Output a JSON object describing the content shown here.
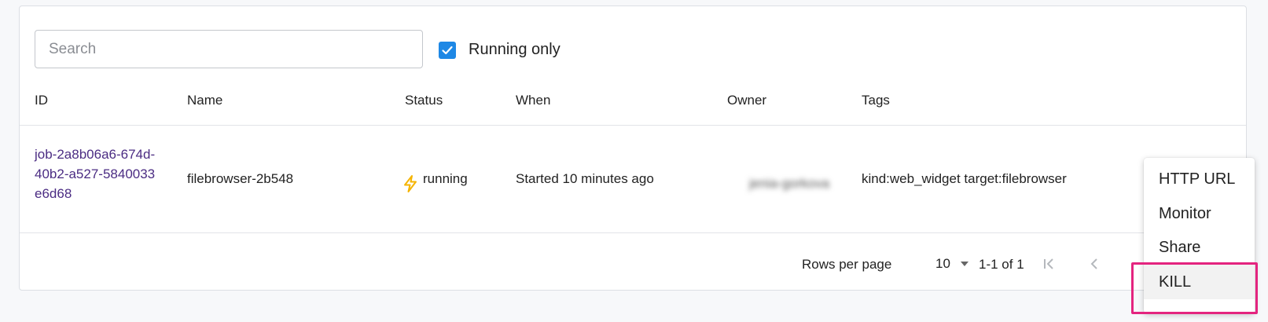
{
  "filters": {
    "search_placeholder": "Search",
    "running_only_label": "Running only",
    "running_only_checked": true
  },
  "table": {
    "columns": [
      "ID",
      "Name",
      "Status",
      "When",
      "Owner",
      "Tags"
    ],
    "rows": [
      {
        "id": "job-2a8b06a6-674d-40b2-a527-5840033e6d68",
        "name": "filebrowser-2b548",
        "status": "running",
        "when": "Started 10 minutes ago",
        "owner": "jenia-gorkova",
        "tags": "kind:web_widget target:filebrowser"
      }
    ]
  },
  "pagination": {
    "rows_per_page_label": "Rows per page",
    "rows_per_page_value": "10",
    "range_label": "1-1 of 1"
  },
  "action_menu": {
    "items": [
      "HTTP URL",
      "Monitor",
      "Share",
      "KILL"
    ],
    "highlighted_item": "KILL"
  },
  "colors": {
    "accent": "#1e88e5",
    "link": "#4b2c83",
    "status_icon": "#f5b400",
    "highlight_box": "#e4247f"
  },
  "icons": {
    "checkbox": "check-icon",
    "status": "lightning-bolt-icon",
    "select": "caret-down-icon",
    "first_page": "first-page-icon",
    "prev_page": "chevron-left-icon"
  }
}
